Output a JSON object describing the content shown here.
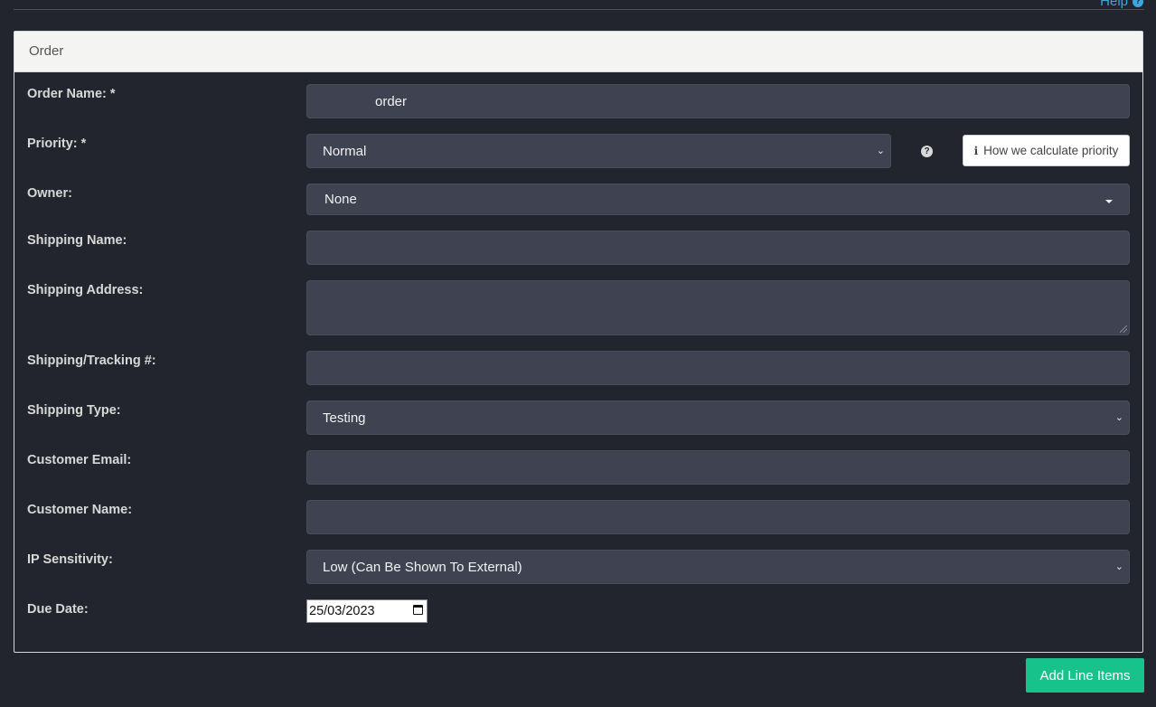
{
  "header": {
    "help_label": "Help",
    "help_icon": "question-circle-icon"
  },
  "panel": {
    "title": "Order"
  },
  "form": {
    "order_name": {
      "label": "Order Name: *",
      "value": "order"
    },
    "priority": {
      "label": "Priority: *",
      "value": "Normal",
      "help_icon": "question-circle-icon",
      "calc_button": "How we calculate priority"
    },
    "owner": {
      "label": "Owner:",
      "value": "None"
    },
    "shipping_name": {
      "label": "Shipping Name:",
      "value": ""
    },
    "shipping_address": {
      "label": "Shipping Address:",
      "value": ""
    },
    "tracking": {
      "label": "Shipping/Tracking #:",
      "value": ""
    },
    "shipping_type": {
      "label": "Shipping Type:",
      "value": "Testing"
    },
    "customer_email": {
      "label": "Customer Email:",
      "value": ""
    },
    "customer_name": {
      "label": "Customer Name:",
      "value": ""
    },
    "ip_sensitivity": {
      "label": "IP Sensitivity:",
      "value": "Low (Can Be Shown To External)"
    },
    "due_date": {
      "label": "Due Date:",
      "value": "25/03/2023"
    }
  },
  "actions": {
    "add_line_items": "Add Line Items"
  },
  "colors": {
    "background": "#22252d",
    "field": "#3f4351",
    "accent": "#17c38a",
    "link": "#3ea6e0"
  }
}
